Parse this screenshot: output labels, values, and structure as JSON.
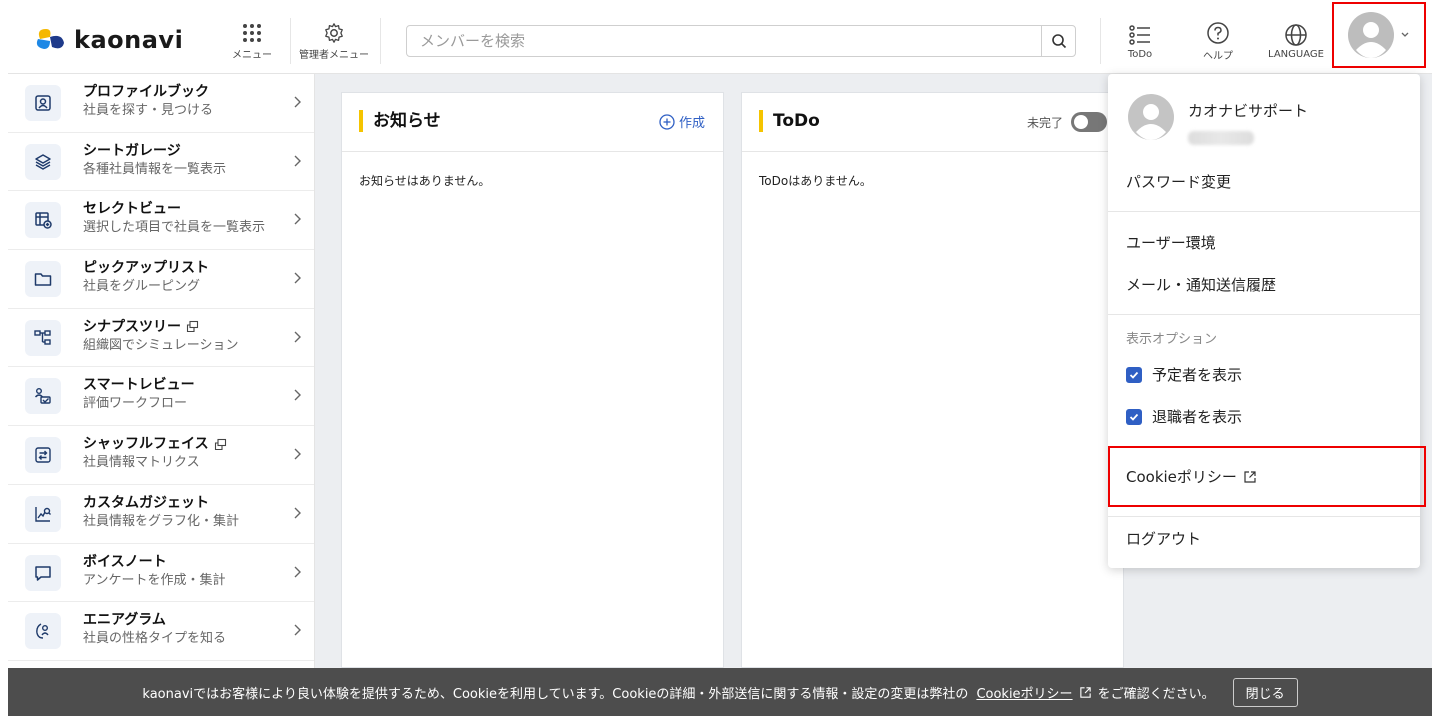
{
  "header": {
    "logo_text": "kaonavi",
    "menu_label": "メニュー",
    "admin_menu_label": "管理者メニュー",
    "search_placeholder": "メンバーを検索",
    "todo_label": "ToDo",
    "help_label": "ヘルプ",
    "language_label": "LANGUAGE"
  },
  "sidebar": {
    "items": [
      {
        "title": "プロファイルブック",
        "sub": "社員を探す・見つける"
      },
      {
        "title": "シートガレージ",
        "sub": "各種社員情報を一覧表示"
      },
      {
        "title": "セレクトビュー",
        "sub": "選択した項目で社員を一覧表示"
      },
      {
        "title": "ピックアップリスト",
        "sub": "社員をグルーピング"
      },
      {
        "title": "シナプスツリー",
        "sub": "組織図でシミュレーション"
      },
      {
        "title": "スマートレビュー",
        "sub": "評価ワークフロー"
      },
      {
        "title": "シャッフルフェイス",
        "sub": "社員情報マトリクス"
      },
      {
        "title": "カスタムガジェット",
        "sub": "社員情報をグラフ化・集計"
      },
      {
        "title": "ボイスノート",
        "sub": "アンケートを作成・集計"
      },
      {
        "title": "エニアグラム",
        "sub": "社員の性格タイプを知る"
      }
    ]
  },
  "notice_panel": {
    "title": "お知らせ",
    "create_label": "作成",
    "empty_text": "お知らせはありません。"
  },
  "todo_panel": {
    "title": "ToDo",
    "toggle_label": "未完了",
    "empty_text": "ToDoはありません。"
  },
  "dropdown": {
    "user_name": "カオナビサポート",
    "password_change": "パスワード変更",
    "user_env": "ユーザー環境",
    "mail_history": "メール・通知送信履歴",
    "display_options_label": "表示オプション",
    "show_planned": "予定者を表示",
    "show_retired": "退職者を表示",
    "cookie_policy": "Cookieポリシー",
    "logout": "ログアウト"
  },
  "cookie_bar": {
    "text": "kaonaviではお客様により良い体験を提供するため、Cookieを利用しています。Cookieの詳細・外部送信に関する情報・設定の変更は弊社の",
    "link": "Cookieポリシー",
    "text_after": "をご確認ください。",
    "close_label": "閉じる"
  },
  "colors": {
    "accent": "#2f5fc4",
    "title_bar": "#f5c400",
    "highlight": "#e00000",
    "cookie_bg": "#4d4d4d"
  }
}
